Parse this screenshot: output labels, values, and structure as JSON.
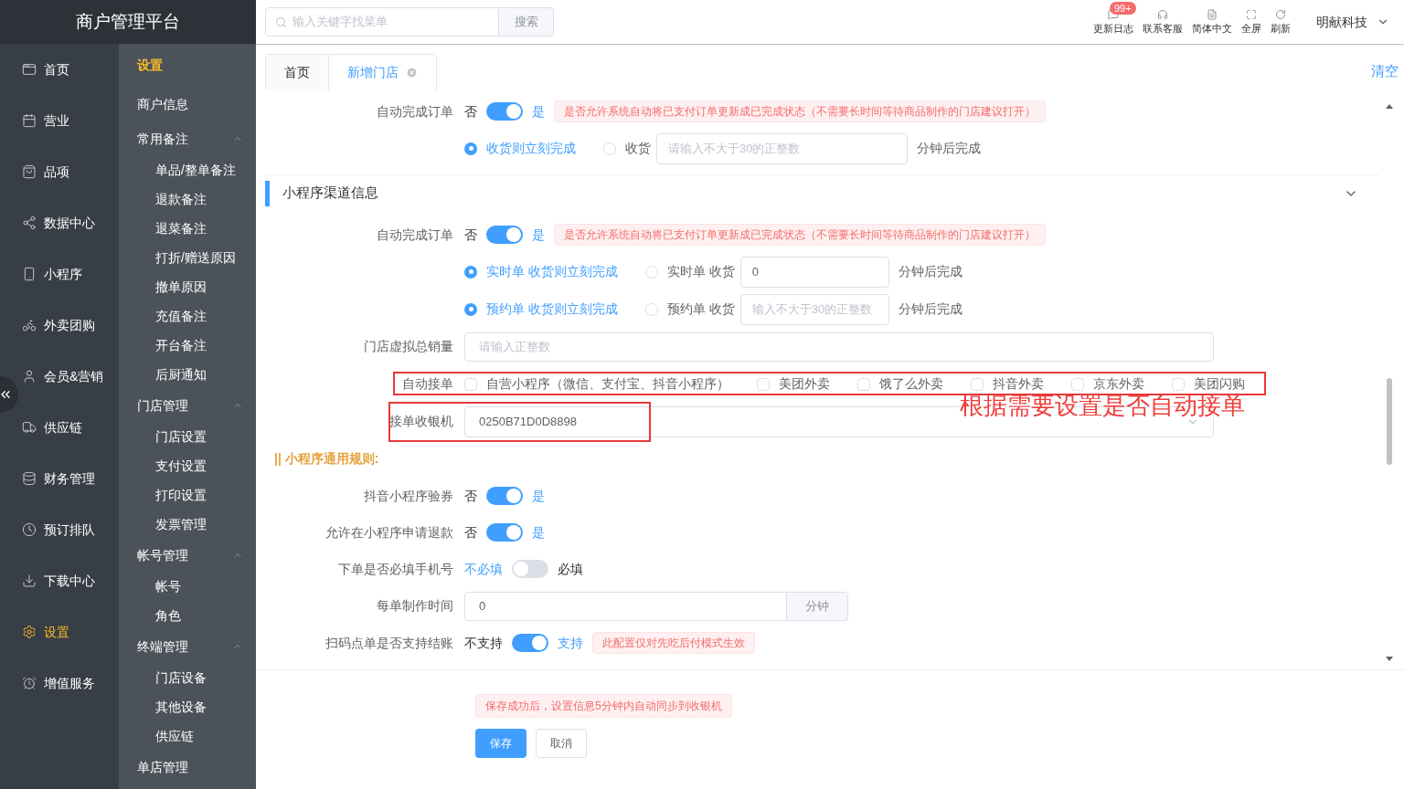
{
  "app_title": "商户管理平台",
  "search": {
    "placeholder": "输入关键字找菜单",
    "button": "搜索"
  },
  "toolbar": [
    {
      "label": "更新日志",
      "badge": "99+"
    },
    {
      "label": "联系客服"
    },
    {
      "label": "简体中文"
    },
    {
      "label": "全屏"
    },
    {
      "label": "刷新"
    }
  ],
  "user": {
    "name": "明献科技"
  },
  "main_nav": [
    {
      "label": "首页",
      "selected": false
    },
    {
      "label": "营业",
      "selected": false
    },
    {
      "label": "品项",
      "selected": false
    },
    {
      "label": "数据中心",
      "selected": false
    },
    {
      "label": "小程序",
      "selected": false
    },
    {
      "label": "外卖团购",
      "selected": false
    },
    {
      "label": "会员&营销",
      "selected": false
    },
    {
      "label": "供应链",
      "selected": false
    },
    {
      "label": "财务管理",
      "selected": false
    },
    {
      "label": "预订排队",
      "selected": false
    },
    {
      "label": "下载中心",
      "selected": false
    },
    {
      "label": "设置",
      "selected": true
    },
    {
      "label": "增值服务",
      "selected": false
    }
  ],
  "sub_nav": {
    "title": "设置",
    "items": [
      {
        "label": "商户信息"
      },
      {
        "label": "常用备注",
        "expanded": true,
        "children": [
          {
            "label": "单品/整单备注"
          },
          {
            "label": "退款备注"
          },
          {
            "label": "退菜备注"
          },
          {
            "label": "打折/赠送原因"
          },
          {
            "label": "撤单原因"
          },
          {
            "label": "充值备注"
          },
          {
            "label": "开台备注"
          },
          {
            "label": "后厨通知"
          }
        ]
      },
      {
        "label": "门店管理",
        "expanded": true,
        "children": [
          {
            "label": "门店设置"
          },
          {
            "label": "支付设置"
          },
          {
            "label": "打印设置"
          },
          {
            "label": "发票管理"
          }
        ]
      },
      {
        "label": "帐号管理",
        "expanded": true,
        "children": [
          {
            "label": "帐号"
          },
          {
            "label": "角色"
          }
        ]
      },
      {
        "label": "终端管理",
        "expanded": true,
        "children": [
          {
            "label": "门店设备"
          },
          {
            "label": "其他设备"
          },
          {
            "label": "供应链"
          }
        ]
      },
      {
        "label": "单店管理"
      }
    ]
  },
  "tabs": [
    {
      "label": "首页",
      "selected": false,
      "closable": false
    },
    {
      "label": "新增门店",
      "selected": true,
      "closable": true
    }
  ],
  "clear_link": "清空",
  "form": [
    {
      "kind": "toggle",
      "label": "自动完成订单",
      "off_text": "否",
      "on_text": "是",
      "on": true,
      "note": "是否允许系统自动将已支付订单更新成已完成状态（不需要长时间等待商品制作的门店建议打开）"
    },
    {
      "kind": "radio",
      "options": [
        {
          "label": "收货则立刻完成",
          "selected": true
        },
        {
          "label": "收货",
          "selected": false
        }
      ],
      "input": {
        "placeholder": "请输入不大于30的正整数"
      },
      "unit": "分钟后完成"
    },
    {
      "kind": "section",
      "title": "小程序渠道信息",
      "expanded": true
    },
    {
      "kind": "toggle",
      "label": "自动完成订单",
      "off_text": "否",
      "on_text": "是",
      "on": true,
      "note": "是否允许系统自动将已支付订单更新成已完成状态（不需要长时间等待商品制作的门店建议打开）"
    },
    {
      "kind": "radio",
      "options": [
        {
          "label": "实时单 收货则立刻完成",
          "selected": true
        },
        {
          "label": "实时单 收货",
          "selected": false
        }
      ],
      "input": {
        "value": "0"
      },
      "unit": "分钟后完成"
    },
    {
      "kind": "radio",
      "options": [
        {
          "label": "预约单 收货则立刻完成",
          "selected": true
        },
        {
          "label": "预约单 收货",
          "selected": false
        }
      ],
      "input": {
        "placeholder": "输入不大于30的正整数"
      },
      "unit": "分钟后完成"
    },
    {
      "kind": "input",
      "label": "门店虚拟总销量",
      "placeholder": "请输入正整数"
    },
    {
      "kind": "checkboxes",
      "label": "自动接单",
      "highlighted": true,
      "options": [
        {
          "label": "自营小程序（微信、支付宝、抖音小程序）",
          "checked": false
        },
        {
          "label": "美团外卖",
          "checked": false
        },
        {
          "label": "饿了么外卖",
          "checked": false
        },
        {
          "label": "抖音外卖",
          "checked": false
        },
        {
          "label": "京东外卖",
          "checked": false
        },
        {
          "label": "美团闪购",
          "checked": false
        }
      ]
    },
    {
      "kind": "select",
      "label": "接单收银机",
      "value": "0250B71D0D8898",
      "highlighted": true,
      "annotation": "根据需要设置是否自动接单"
    },
    {
      "kind": "heading",
      "text": "|| 小程序通用规则:"
    },
    {
      "kind": "toggle",
      "label": "抖音小程序验券",
      "off_text": "否",
      "on_text": "是",
      "on": true
    },
    {
      "kind": "toggle",
      "label": "允许在小程序申请退款",
      "off_text": "否",
      "on_text": "是",
      "on": true
    },
    {
      "kind": "toggle",
      "label": "下单是否必填手机号",
      "off_text": "不必填",
      "on_text": "必填",
      "on": false
    },
    {
      "kind": "input_unit",
      "label": "每单制作时间",
      "value": "0",
      "unit": "分钟"
    },
    {
      "kind": "toggle",
      "label": "扫码点单是否支持结账",
      "off_text": "不支持",
      "on_text": "支持",
      "on": true,
      "note": "此配置仅对先吃后付模式生效"
    }
  ],
  "footer": {
    "note": "保存成功后，设置信息5分钟内自动同步到收银机",
    "buttons": [
      {
        "label": "保存",
        "primary": true
      },
      {
        "label": "取消",
        "primary": false
      }
    ]
  }
}
